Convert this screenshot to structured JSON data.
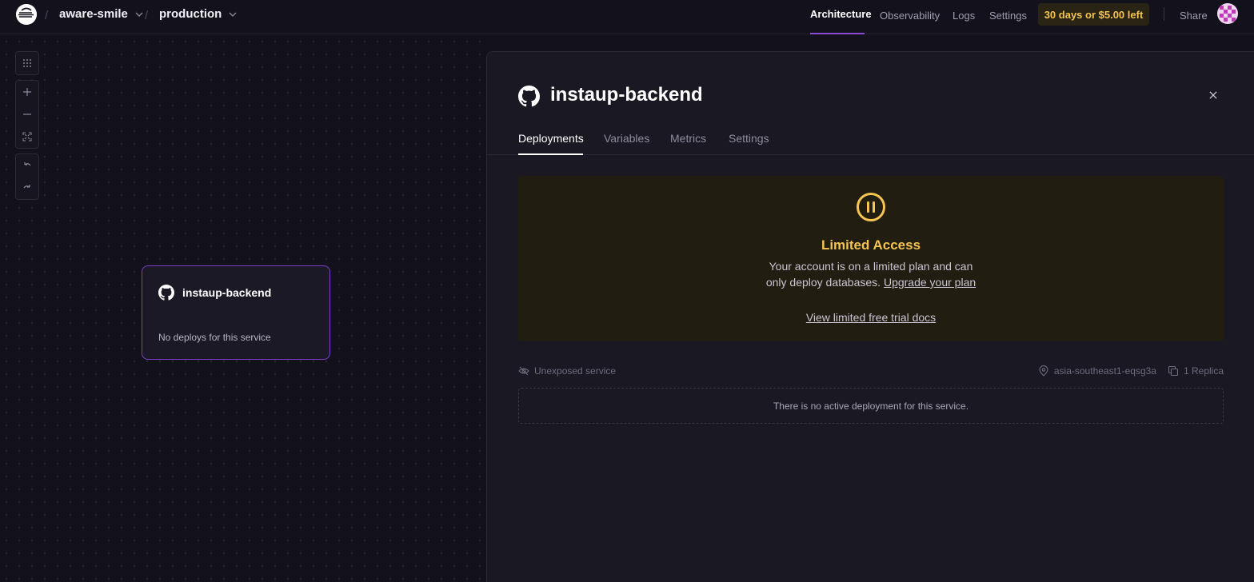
{
  "header": {
    "project": "aware-smile",
    "environment": "production",
    "nav": [
      "Architecture",
      "Observability",
      "Logs",
      "Settings"
    ],
    "active_nav": "Architecture",
    "trial_badge": "30 days or $5.00 left",
    "share": "Share"
  },
  "canvas": {
    "node": {
      "title": "instaup-backend",
      "status": "No deploys for this service",
      "icon": "github-icon"
    },
    "tools": [
      "grid-icon",
      "zoom-in-icon",
      "zoom-out-icon",
      "fit-view-icon",
      "undo-icon",
      "redo-icon"
    ]
  },
  "panel": {
    "title": "instaup-backend",
    "tabs": [
      "Deployments",
      "Variables",
      "Metrics",
      "Settings"
    ],
    "active_tab": "Deployments",
    "limited": {
      "title": "Limited Access",
      "line1": "Your account is on a limited plan and can",
      "line2": "only deploy databases.",
      "upgrade_link": "Upgrade your plan",
      "docs_link": "View limited free trial docs"
    },
    "meta": {
      "exposure": "Unexposed service",
      "region": "asia-southeast1-eqsg3a",
      "replicas": "1 Replica"
    },
    "empty_message": "There is no active deployment for this service."
  },
  "colors": {
    "background": "#13111c",
    "accent_purple": "#8a4bd6",
    "warning_yellow": "#f5c451"
  }
}
